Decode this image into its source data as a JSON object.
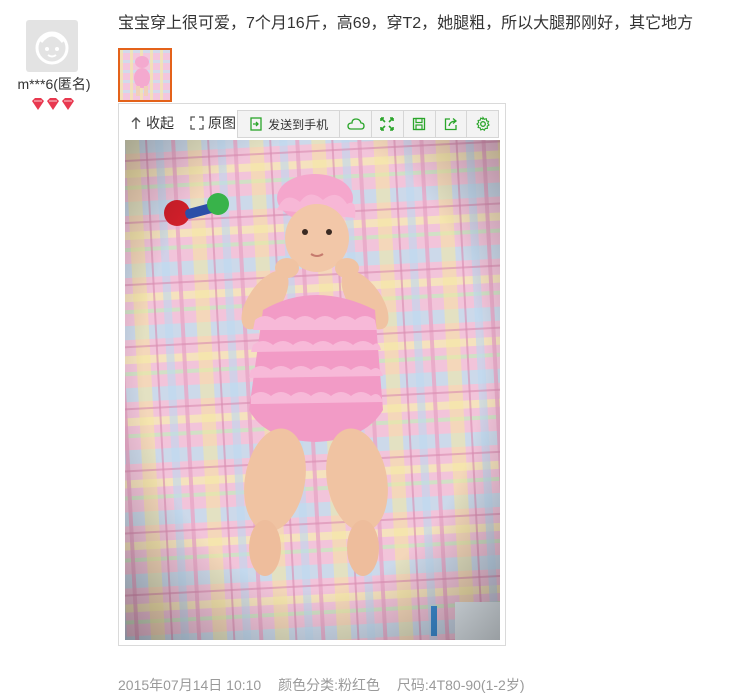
{
  "review": {
    "user": {
      "name": "m***6(匿名)",
      "avatar_icon": "default-avatar-icon",
      "level_icon": "red-gem-icon",
      "level_gem_count": 3
    },
    "text": "宝宝穿上很可爱，7个月16斤，高69，穿T2，她腿粗，所以大腿那刚好，其它地方",
    "viewer": {
      "collapse_label": "收起",
      "original_label": "原图",
      "send_to_phone_label": "发送到手机",
      "toolbar_icons": [
        "send-phone-icon",
        "cloud-icon",
        "fullscreen-icon",
        "save-icon",
        "share-icon",
        "settings-icon"
      ]
    },
    "meta": {
      "date": "2015年07月14日 10:10",
      "color": "颜色分类:粉红色",
      "size": "尺码:4T80-90(1-2岁)"
    }
  },
  "colors": {
    "thumb_border": "#e4621a",
    "gem": "#e8384f",
    "toolbar_icon": "#2aa52a",
    "meta_text": "#9a9a9a"
  }
}
